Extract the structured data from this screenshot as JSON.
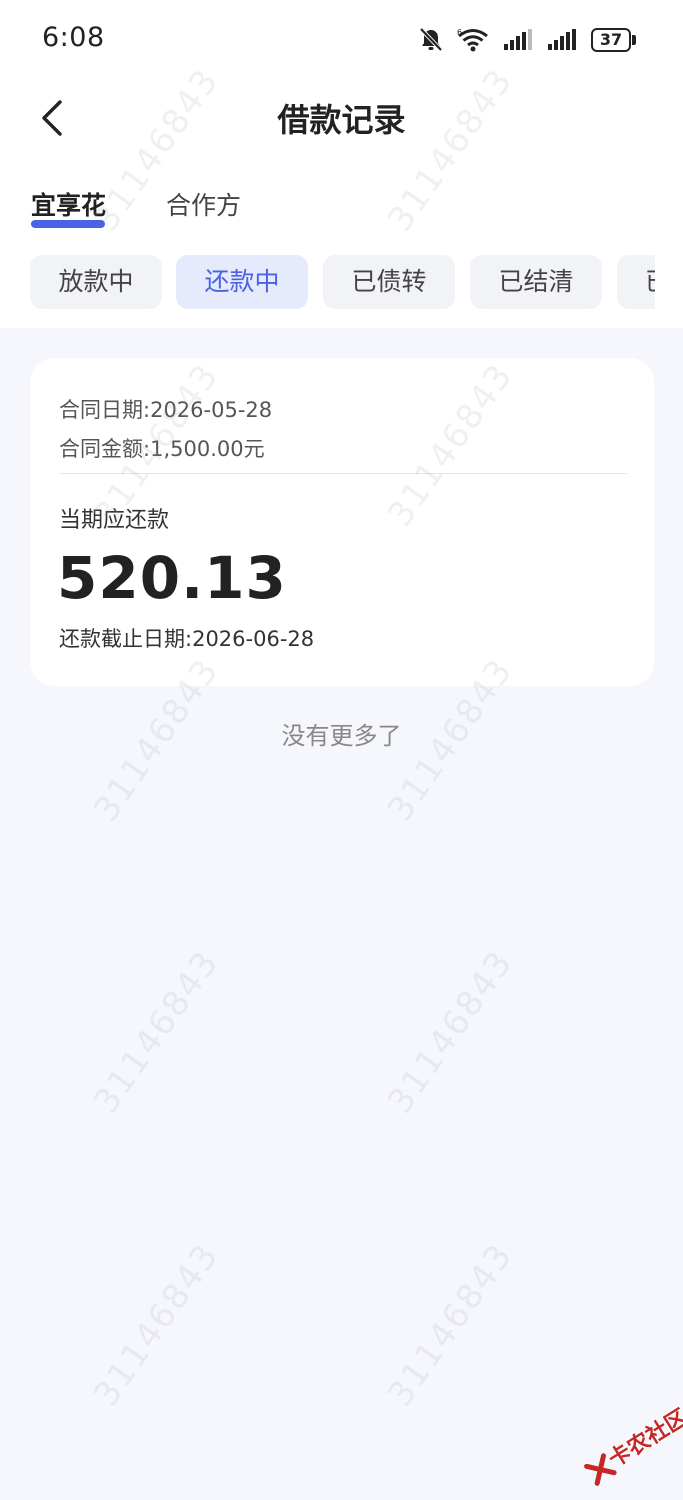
{
  "status_bar": {
    "time": "6:08",
    "battery_level": "37",
    "icons": [
      "bell-off-icon",
      "wifi-icon",
      "signal-icon",
      "signal-icon",
      "battery-icon"
    ]
  },
  "header": {
    "title": "借款记录",
    "back_icon": "chevron-left-icon"
  },
  "provider_tabs": [
    {
      "label": "宜享花",
      "active": true
    },
    {
      "label": "合作方",
      "active": false
    }
  ],
  "status_filters": [
    {
      "label": "放款中",
      "active": false
    },
    {
      "label": "还款中",
      "active": true
    },
    {
      "label": "已债转",
      "active": false
    },
    {
      "label": "已结清",
      "active": false
    },
    {
      "label": "已",
      "active": false
    }
  ],
  "loan_card": {
    "contract_date_label": "合同日期:",
    "contract_date": "2026-05-28",
    "contract_amount_label": "合同金额:",
    "contract_amount": "1,500.00元",
    "due_label": "当期应还款",
    "due_amount": "520.13",
    "due_date_label": "还款截止日期:",
    "due_date": "2026-06-28"
  },
  "list_footer": "没有更多了",
  "watermark_text": "31146843",
  "corner_logo_text": "卡农社区",
  "colors": {
    "accent": "#4b63e3",
    "chip_active_bg": "#e5eafc",
    "chip_bg": "#f2f3f7",
    "page_bg": "#f6f7fc",
    "logo_red": "#c62828"
  }
}
